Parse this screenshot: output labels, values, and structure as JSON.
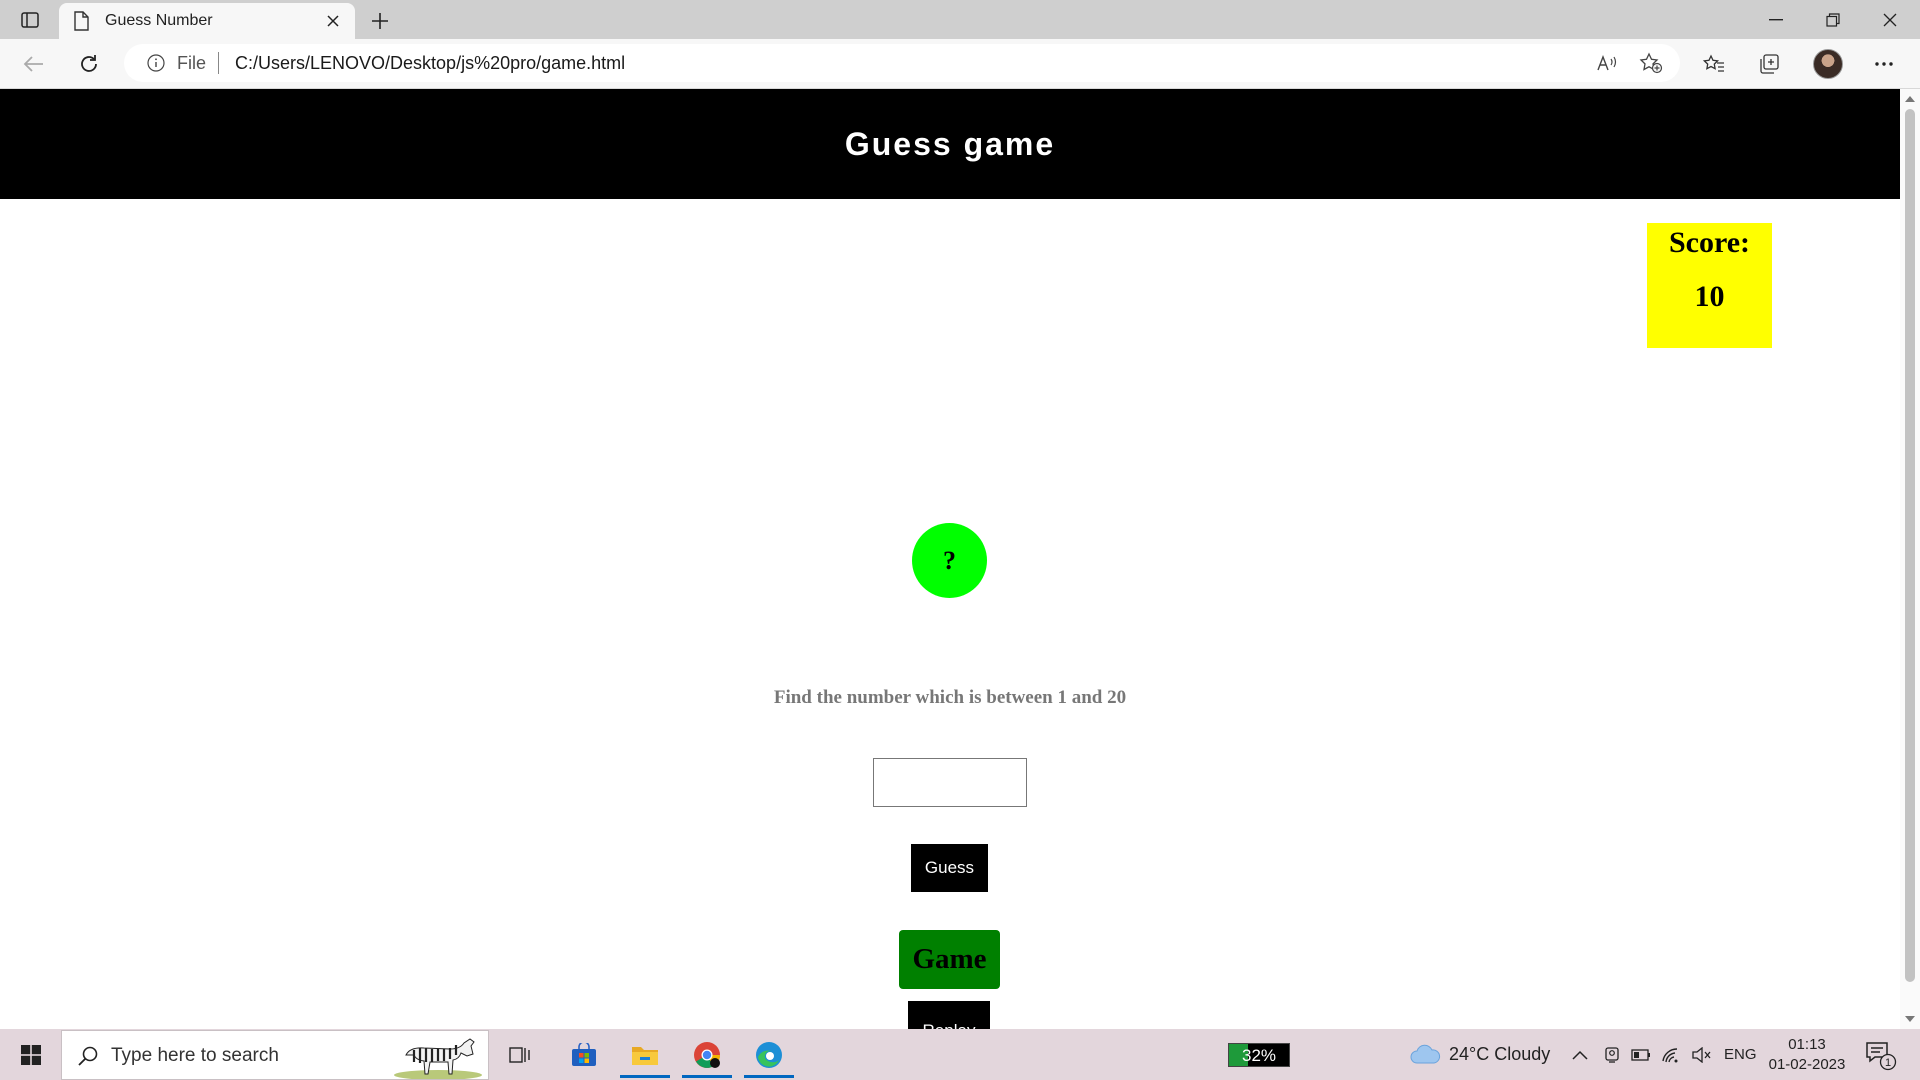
{
  "browser": {
    "tab_title": "Guess Number",
    "address_scheme": "File",
    "address_url": "C:/Users/LENOVO/Desktop/js%20pro/game.html"
  },
  "game": {
    "header_title": "Guess game",
    "score_label": "Score:",
    "score_value": "10",
    "mystery_symbol": "?",
    "hint_text": "Find the number which is between 1 and 20",
    "guess_input_value": "",
    "guess_button_label": "Guess",
    "game_button_label": "Game",
    "replay_button_label": "Replay",
    "colors": {
      "header_bg": "#000000",
      "score_bg": "#ffff00",
      "mystery_bg": "#00ff00",
      "game_button_bg": "#008000"
    }
  },
  "taskbar": {
    "search_placeholder": "Type here to search",
    "battery_percent_label": "32%",
    "battery_level": 0.32,
    "weather_text": "24°C  Cloudy",
    "language": "ENG",
    "clock_time": "01:13",
    "clock_date": "01-02-2023",
    "notification_count": "1",
    "pinned_apps": [
      "task-view-icon",
      "microsoft-store-icon",
      "file-explorer-icon",
      "chrome-icon",
      "edge-icon"
    ]
  }
}
